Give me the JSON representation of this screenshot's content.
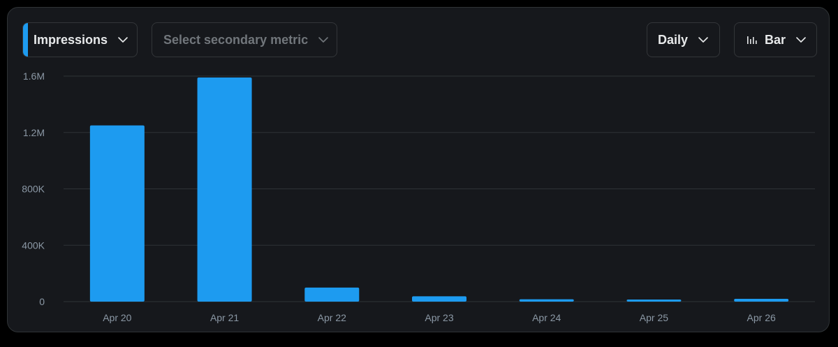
{
  "controls": {
    "primary_metric": "Impressions",
    "secondary_metric_placeholder": "Select secondary metric",
    "interval": "Daily",
    "chart_type_label": "Bar"
  },
  "colors": {
    "accent": "#1d9bf0",
    "bar": "#1d9bf0",
    "card_background": "#16181c",
    "grid": "#2f3336",
    "tick_text": "#8b98a5"
  },
  "chart_data": {
    "type": "bar",
    "categories": [
      "Apr 20",
      "Apr 21",
      "Apr 22",
      "Apr 23",
      "Apr 24",
      "Apr 25",
      "Apr 26"
    ],
    "values": [
      1250000,
      1590000,
      100000,
      38000,
      17000,
      13000,
      20000
    ],
    "ylim": [
      0,
      1600000
    ],
    "y_ticks": [
      0,
      400000,
      800000,
      1200000,
      1600000
    ],
    "y_tick_labels": [
      "0",
      "400K",
      "800K",
      "1.2M",
      "1.6M"
    ],
    "grid": true
  }
}
